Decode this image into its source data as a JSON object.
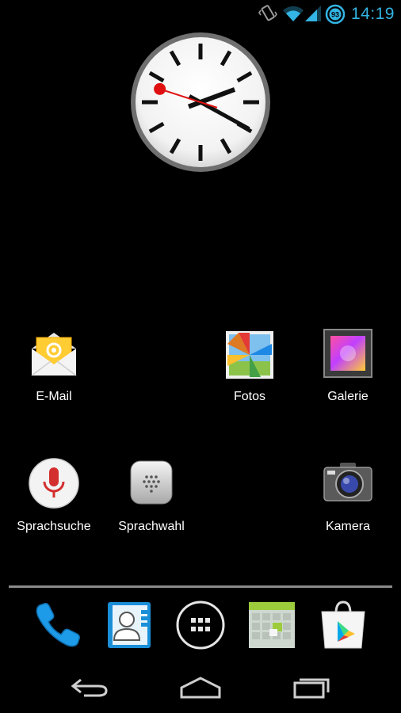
{
  "status_bar": {
    "time": "14:19",
    "battery_level": "93",
    "icons": [
      "vibrate-icon",
      "wifi-icon",
      "signal-icon",
      "battery-icon"
    ],
    "accent_color": "#33b5e5"
  },
  "clock": {
    "hour": 14,
    "minute": 19,
    "second": 48
  },
  "apps": [
    {
      "label": "E-Mail",
      "icon": "email-icon"
    },
    {
      "label": "Fotos",
      "icon": "photos-icon"
    },
    {
      "label": "Galerie",
      "icon": "gallery-icon"
    },
    {
      "label": "Sprachsuche",
      "icon": "microphone-icon"
    },
    {
      "label": "Sprachwahl",
      "icon": "voice-dialer-icon"
    },
    {
      "label": "Kamera",
      "icon": "camera-icon"
    }
  ],
  "dock": [
    {
      "icon": "phone-icon"
    },
    {
      "icon": "contacts-icon"
    },
    {
      "icon": "app-drawer-icon"
    },
    {
      "icon": "calendar-icon"
    },
    {
      "icon": "play-store-icon"
    }
  ],
  "nav": [
    {
      "icon": "back-icon"
    },
    {
      "icon": "home-icon"
    },
    {
      "icon": "recent-apps-icon"
    }
  ]
}
